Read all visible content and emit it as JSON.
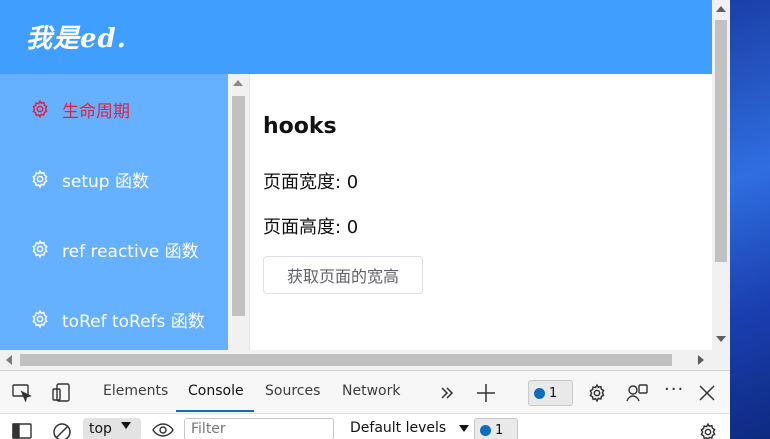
{
  "app": {
    "logo_text": "我是ed."
  },
  "sidebar": {
    "items": [
      {
        "label": "生命周期",
        "active": true
      },
      {
        "label": "setup 函数",
        "active": false
      },
      {
        "label": "ref reactive 函数",
        "active": false
      },
      {
        "label": "toRef toRefs 函数",
        "active": false
      }
    ]
  },
  "main": {
    "heading": "hooks",
    "width_line": "页面宽度: 0",
    "height_line": "页面高度: 0",
    "button_label": "获取页面的宽高"
  },
  "devtools": {
    "tabs": [
      {
        "label": "Elements",
        "active": false
      },
      {
        "label": "Console",
        "active": true
      },
      {
        "label": "Sources",
        "active": false
      },
      {
        "label": "Network",
        "active": false
      }
    ],
    "issues_count": "1",
    "messages_count": "1",
    "context_selector": "top",
    "filter_placeholder": "Filter",
    "levels_label": "Default levels"
  },
  "colors": {
    "header": "#409eff",
    "sidebar": "#66b1ff",
    "active_menu": "#e61e3c",
    "accent": "#0f6cbd"
  }
}
